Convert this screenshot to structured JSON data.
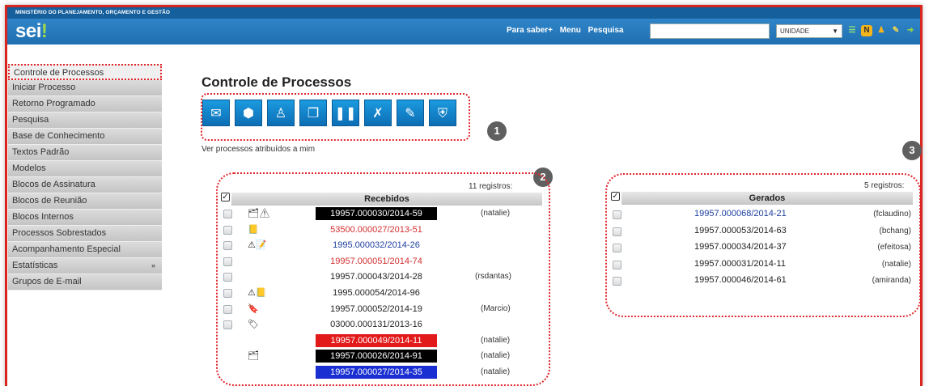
{
  "header": {
    "ministry": "MINISTÉRIO DO PLANEJAMENTO, ORÇAMENTO E GESTÃO",
    "logo_text": "sei",
    "logo_dot": "!",
    "nav": [
      "Para saber+",
      "Menu",
      "Pesquisa"
    ],
    "unit_select": "UNIDADE",
    "icons": [
      "menu-icon",
      "notification-icon",
      "user-icon",
      "tools-icon",
      "exit-icon"
    ]
  },
  "sidebar": {
    "items": [
      {
        "label": "Controle de Processos"
      },
      {
        "label": "Iniciar Processo"
      },
      {
        "label": "Retorno Programado"
      },
      {
        "label": "Pesquisa"
      },
      {
        "label": "Base de Conhecimento"
      },
      {
        "label": "Textos Padrão"
      },
      {
        "label": "Modelos"
      },
      {
        "label": "Blocos de Assinatura"
      },
      {
        "label": "Blocos de Reunião"
      },
      {
        "label": "Blocos Internos"
      },
      {
        "label": "Processos Sobrestados"
      },
      {
        "label": "Acompanhamento Especial"
      },
      {
        "label": "Estatísticas",
        "arrow": "»"
      },
      {
        "label": "Grupos de E-mail"
      }
    ]
  },
  "main": {
    "title": "Controle de Processos",
    "toolbar_icons": [
      "send-process-icon",
      "update-status-icon",
      "assign-user-icon",
      "documents-icon",
      "pause-icon",
      "exclude-icon",
      "annotation-icon",
      "shield-icon"
    ],
    "badges": [
      "1",
      "2",
      "3"
    ],
    "assigned_link": "Ver processos atribuídos a mim"
  },
  "received": {
    "count": "11 registros:",
    "header": "Recebidos",
    "rows": [
      {
        "number": "19957.000030/2014-59",
        "user": "(natalie)",
        "icons": "🗂⚠",
        "style": "black"
      },
      {
        "number": "53500.000027/2013-51",
        "user": "",
        "icons": "📒",
        "style": "red"
      },
      {
        "number": "1995.000032/2014-26",
        "user": "",
        "icons": "⚠📝",
        "style": "blue"
      },
      {
        "number": "19957.000051/2014-74",
        "user": "",
        "icons": "",
        "style": "red"
      },
      {
        "number": "19957.000043/2014-28",
        "user": "(rsdantas)",
        "icons": "",
        "style": "plain"
      },
      {
        "number": "1995.000054/2014-96",
        "user": "",
        "icons": "⚠📒",
        "style": "plain"
      },
      {
        "number": "19957.000052/2014-19",
        "user": "(Marcio)",
        "icons": "🔖",
        "style": "plain"
      },
      {
        "number": "03000.000131/2013-16",
        "user": "",
        "icons": "🏷",
        "style": "plain"
      },
      {
        "number": "19957.000049/2014-11",
        "user": "(natalie)",
        "icons": "",
        "style": "red-bg"
      },
      {
        "number": "19957.000026/2014-91",
        "user": "(natalie)",
        "icons": "🗂",
        "style": "black"
      },
      {
        "number": "19957.000027/2014-35",
        "user": "(natalie)",
        "icons": "",
        "style": "blue-bg"
      }
    ]
  },
  "generated": {
    "count": "5 registros:",
    "header": "Gerados",
    "rows": [
      {
        "number": "19957.000068/2014-21",
        "user": "(fclaudino)",
        "style": "blue"
      },
      {
        "number": "19957.000053/2014-63",
        "user": "(bchang)",
        "style": "plain"
      },
      {
        "number": "19957.000034/2014-37",
        "user": "(efeitosa)",
        "style": "plain"
      },
      {
        "number": "19957.000031/2014-11",
        "user": "(natalie)",
        "style": "plain"
      },
      {
        "number": "19957.000046/2014-61",
        "user": "(amiranda)",
        "style": "plain"
      }
    ]
  },
  "colors": {
    "header_blue": "#1f6fb1",
    "annotation_red": "#e0262d",
    "link_blue": "#1d3fa0",
    "link_red": "#d32f2f"
  }
}
